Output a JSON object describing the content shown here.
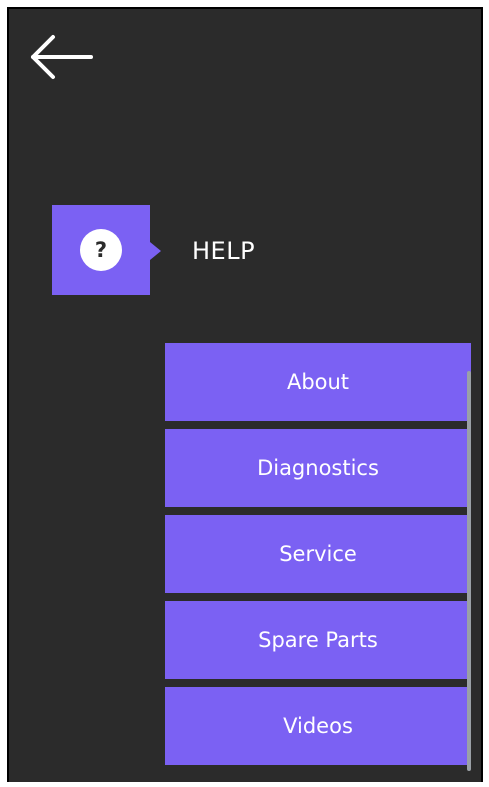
{
  "header": {
    "back_icon": "arrow-left-icon"
  },
  "help": {
    "icon": "question-mark-icon",
    "icon_glyph": "?",
    "title": "HELP",
    "accent_color": "#7b61f3"
  },
  "menu": {
    "items": [
      {
        "label": "About"
      },
      {
        "label": "Diagnostics"
      },
      {
        "label": "Service"
      },
      {
        "label": "Spare Parts"
      },
      {
        "label": "Videos"
      }
    ]
  },
  "theme": {
    "background": "#2b2b2b",
    "text": "#ffffff",
    "accent": "#7b61f3"
  }
}
